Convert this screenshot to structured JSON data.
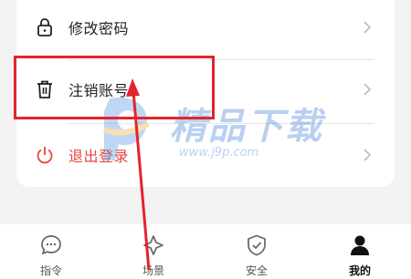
{
  "menu": {
    "items": [
      {
        "label": "修改密码",
        "icon": "lock-icon"
      },
      {
        "label": "注销账号",
        "icon": "trash-icon"
      },
      {
        "label": "退出登录",
        "icon": "power-icon"
      }
    ]
  },
  "watermark": {
    "title": "精品下载",
    "url": "www.j9p.com"
  },
  "tabbar": {
    "tabs": [
      {
        "label": "指令",
        "icon": "chat-bubble-icon"
      },
      {
        "label": "场景",
        "icon": "scene-icon"
      },
      {
        "label": "安全",
        "icon": "shield-check-icon"
      },
      {
        "label": "我的",
        "icon": "user-icon"
      }
    ],
    "active_index": 3
  },
  "colors": {
    "accent_red": "#e3242b",
    "logout_red": "#e8453c",
    "watermark_blue": "#3a7bd5"
  }
}
